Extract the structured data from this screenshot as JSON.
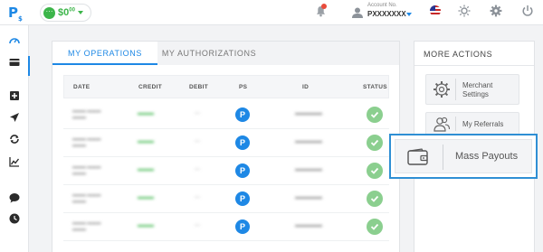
{
  "app": {
    "logo": "P",
    "logo_sub": "$"
  },
  "balance": {
    "icon_text": "···",
    "amount": "$0",
    "cents": "00"
  },
  "account": {
    "label": "Account No.",
    "number": "PXXXXXXX"
  },
  "tabs": [
    {
      "label": "MY OPERATIONS",
      "active": true
    },
    {
      "label": "MY AUTHORIZATIONS",
      "active": false
    }
  ],
  "table": {
    "columns": [
      "DATE",
      "CREDIT",
      "DEBIT",
      "PS",
      "ID",
      "STATUS"
    ],
    "ps_label": "P"
  },
  "more_actions": {
    "title": "MORE ACTIONS",
    "merchant_settings_line1": "Merchant",
    "merchant_settings_line2": "Settings",
    "my_referrals": "My Referrals",
    "mass_payouts": "Mass Payouts"
  },
  "colors": {
    "accent": "#1e88e5",
    "positive": "#3cb54a",
    "highlight_border": "#2f8fd4"
  }
}
